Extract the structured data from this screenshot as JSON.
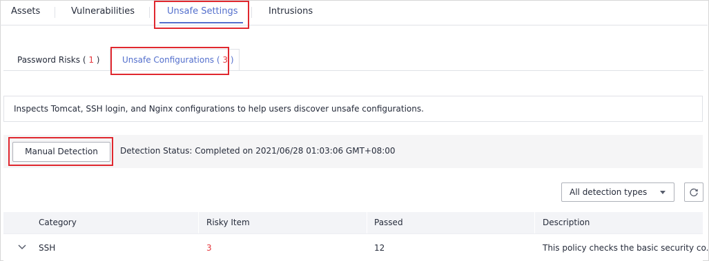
{
  "top_tabs": [
    {
      "label": "Assets",
      "active": false
    },
    {
      "label": "Vulnerabilities",
      "active": false
    },
    {
      "label": "Unsafe Settings",
      "active": true
    },
    {
      "label": "Intrusions",
      "active": false
    }
  ],
  "sub_tabs": [
    {
      "label": "Password Risks",
      "count": "1",
      "active": false
    },
    {
      "label": "Unsafe Configurations",
      "count": "3",
      "active": true
    }
  ],
  "info": {
    "text": "Inspects Tomcat, SSH login, and Nginx configurations to help users discover unsafe configurations."
  },
  "detection": {
    "button_label": "Manual Detection",
    "status_text": "Detection Status: Completed on 2021/06/28 01:03:06 GMT+08:00"
  },
  "filter": {
    "selected": "All detection types",
    "refresh_icon": "refresh-icon"
  },
  "table": {
    "columns": [
      "Category",
      "Risky Item",
      "Passed",
      "Description"
    ],
    "rows": [
      {
        "category": "SSH",
        "risky_item": "3",
        "passed": "12",
        "description": "This policy checks the basic security co..."
      }
    ]
  },
  "colors": {
    "accent": "#526ecc",
    "highlight_box": "#e0272e",
    "risk": "#e5353b"
  }
}
